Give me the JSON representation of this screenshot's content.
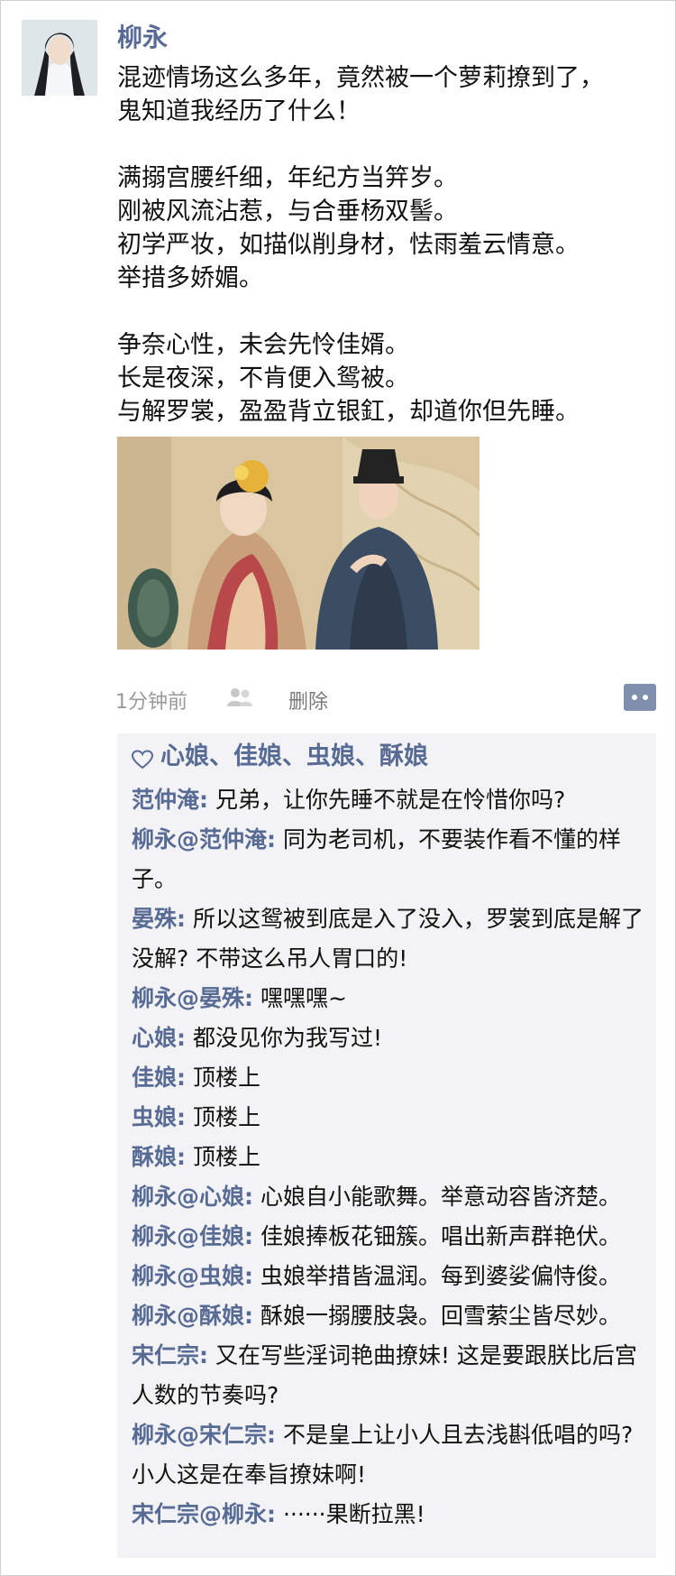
{
  "post": {
    "author": "柳永",
    "lines": [
      "混迹情场这么多年，竟然被一个萝莉撩到了，",
      "鬼知道我经历了什么！",
      "",
      "满搦宫腰纤细，年纪方当笄岁。",
      "刚被风流沾惹，与合垂杨双髻。",
      "初学严妆，如描似削身材，怯雨羞云情意。",
      "举措多娇媚。",
      "",
      "争奈心性，未会先怜佳婿。",
      "长是夜深，不肯便入鸳被。",
      "与解罗裳，盈盈背立银釭，却道你但先睡。"
    ],
    "time": "1分钟前",
    "delete_label": "删除"
  },
  "likes": "心娘、佳娘、虫娘、酥娘",
  "comments": [
    {
      "who": "范仲淹:",
      "text": "兄弟，让你先睡不就是在怜惜你吗?"
    },
    {
      "who": "柳永@范仲淹:",
      "text": "同为老司机，不要装作看不懂的样子。"
    },
    {
      "who": "晏殊:",
      "text": "所以这鸳被到底是入了没入，罗裳到底是解了没解? 不带这么吊人胃口的!"
    },
    {
      "who": "柳永@晏殊:",
      "text": "嘿嘿嘿~"
    },
    {
      "who": "心娘:",
      "text": "都没见你为我写过!"
    },
    {
      "who": "佳娘:",
      "text": "顶楼上"
    },
    {
      "who": "虫娘:",
      "text": "顶楼上"
    },
    {
      "who": "酥娘:",
      "text": "顶楼上"
    },
    {
      "who": "柳永@心娘:",
      "text": "心娘自小能歌舞。举意动容皆济楚。"
    },
    {
      "who": "柳永@佳娘:",
      "text": "佳娘捧板花钿簇。唱出新声群艳伏。"
    },
    {
      "who": "柳永@虫娘:",
      "text": "虫娘举措皆温润。每到婆娑偏恃俊。"
    },
    {
      "who": "柳永@酥娘:",
      "text": "酥娘一搦腰肢袅。回雪萦尘皆尽妙。"
    },
    {
      "who": "宋仁宗:",
      "text": "又在写些淫词艳曲撩妹! 这是要跟朕比后宫人数的节奏吗?"
    },
    {
      "who": "柳永@宋仁宗:",
      "text": "不是皇上让小人且去浅斟低唱的吗? 小人这是在奉旨撩妹啊!"
    },
    {
      "who": "宋仁宗@柳永:",
      "text": "······果断拉黑!"
    }
  ],
  "icons": {
    "friends": "friends-icon",
    "comment": "comment-bubble-icon",
    "heart": "heart-icon"
  },
  "colors": {
    "name_blue": "#576b95",
    "comment_bg": "#f3f3f5",
    "meta_gray": "#9a9a9a"
  }
}
